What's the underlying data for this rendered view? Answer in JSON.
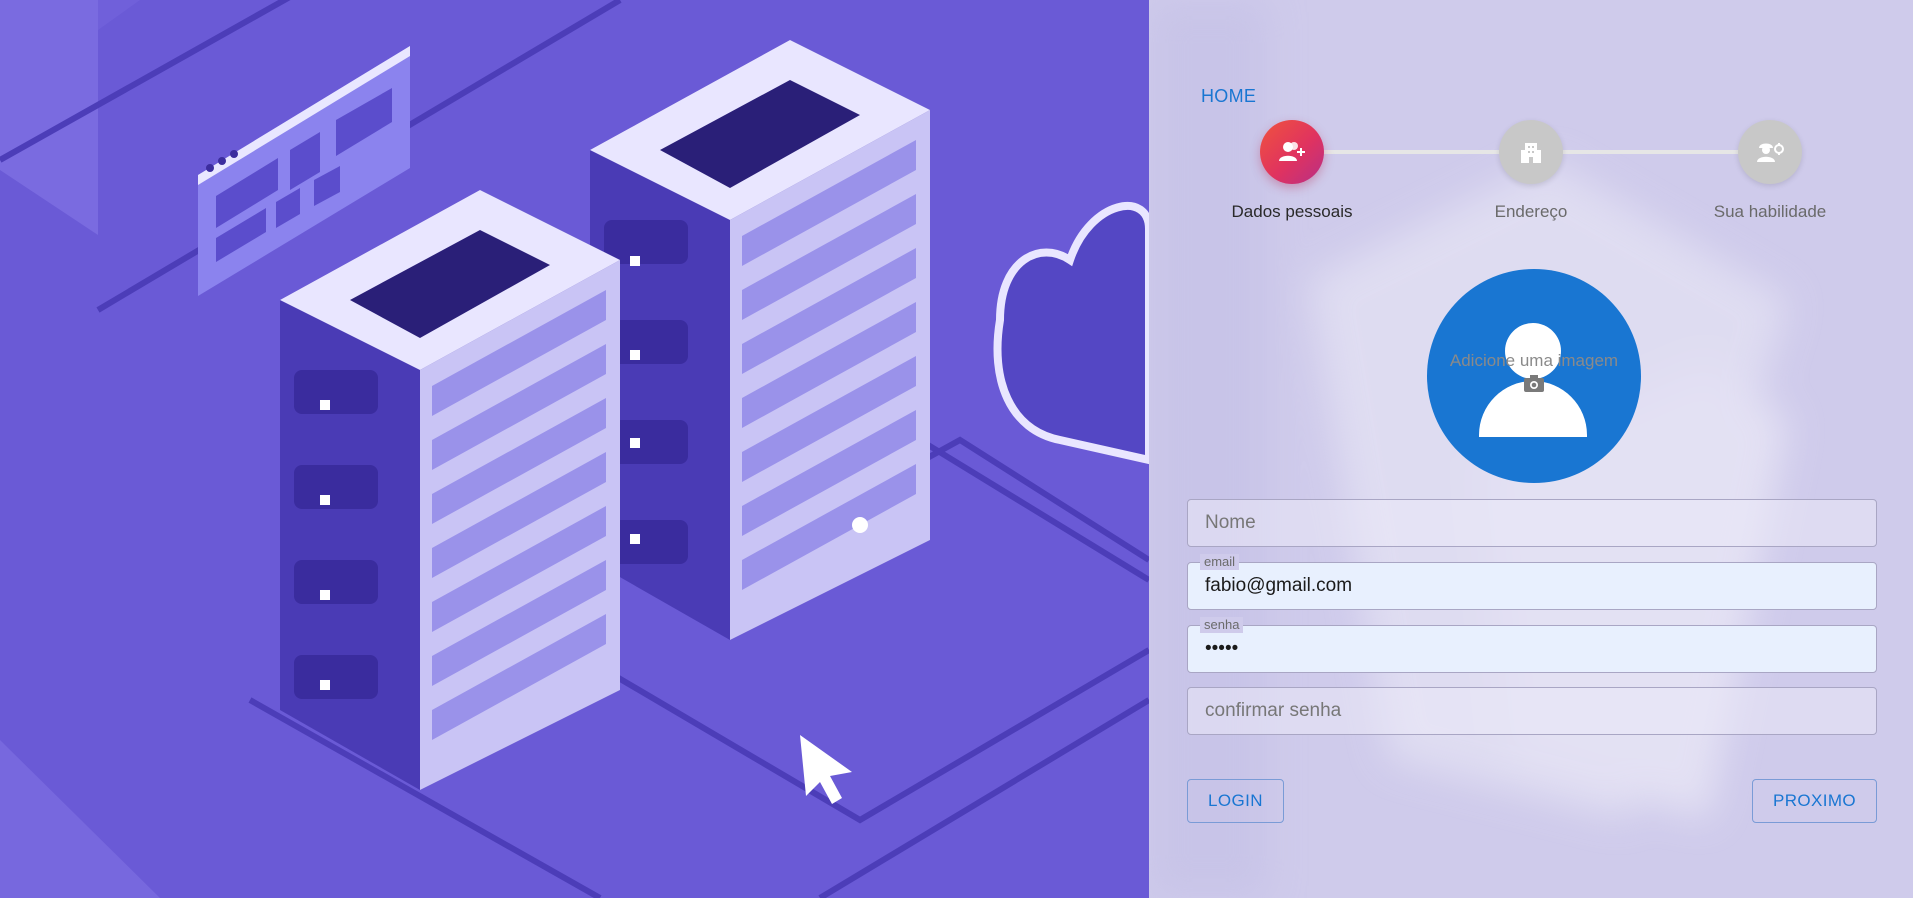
{
  "nav": {
    "home_label": "HOME"
  },
  "stepper": {
    "steps": [
      {
        "label": "Dados pessoais",
        "icon": "person-add-icon",
        "active": true
      },
      {
        "label": "Endereço",
        "icon": "building-icon",
        "active": false
      },
      {
        "label": "Sua habilidade",
        "icon": "engineer-icon",
        "active": false
      }
    ]
  },
  "avatar": {
    "caption": "Adicione uma imagem",
    "icon": "camera-icon"
  },
  "form": {
    "nome": {
      "placeholder": "Nome",
      "value": ""
    },
    "email": {
      "label": "email",
      "value": "fabio@gmail.com"
    },
    "senha": {
      "label": "senha",
      "value": "•••••"
    },
    "confirmar": {
      "placeholder": "confirmar senha",
      "value": ""
    }
  },
  "actions": {
    "login_label": "LOGIN",
    "next_label": "PROXIMO"
  },
  "colors": {
    "accent": "#1976d2",
    "illustration_bg": "#6a5ad6",
    "panel_bg": "#cfcbeb",
    "active_step_start": "#f0533d",
    "active_step_end": "#b72f86"
  }
}
